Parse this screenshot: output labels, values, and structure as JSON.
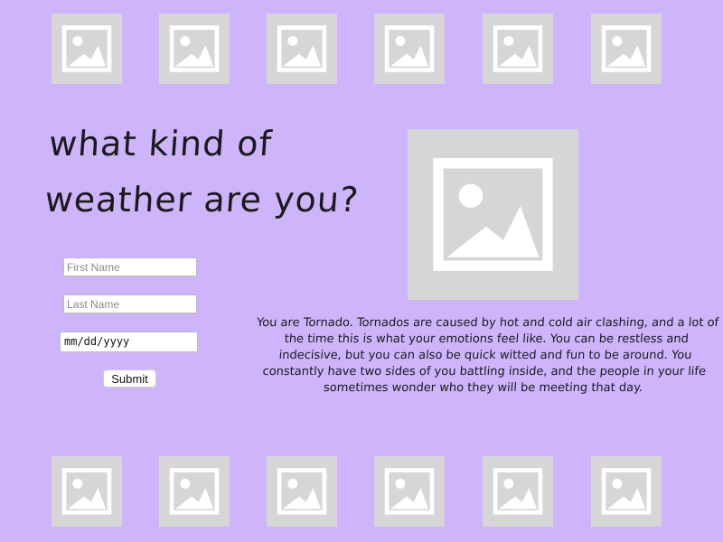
{
  "headline": "what kind of weather are you?",
  "form": {
    "first_name_placeholder": "First Name",
    "last_name_placeholder": "Last Name",
    "date_placeholder": "mm/dd/yyyy",
    "submit_label": "Submit"
  },
  "result": {
    "text": "You are Tornado. Tornados are caused by hot and cold air clashing,  and a lot of the time this is what your emotions feel like. You can be restless and indecisive, but you can also be quick witted and fun to be around. You constantly have two sides of you battling inside, and the people  in your life sometimes wonder who they will be meeting that day."
  },
  "icons": {
    "thumbnail": "image-placeholder-icon",
    "feature": "image-placeholder-icon"
  },
  "colors": {
    "background": "#cdb4fb",
    "placeholder_tile": "#d6d6d6",
    "placeholder_glyph": "#ffffff"
  }
}
